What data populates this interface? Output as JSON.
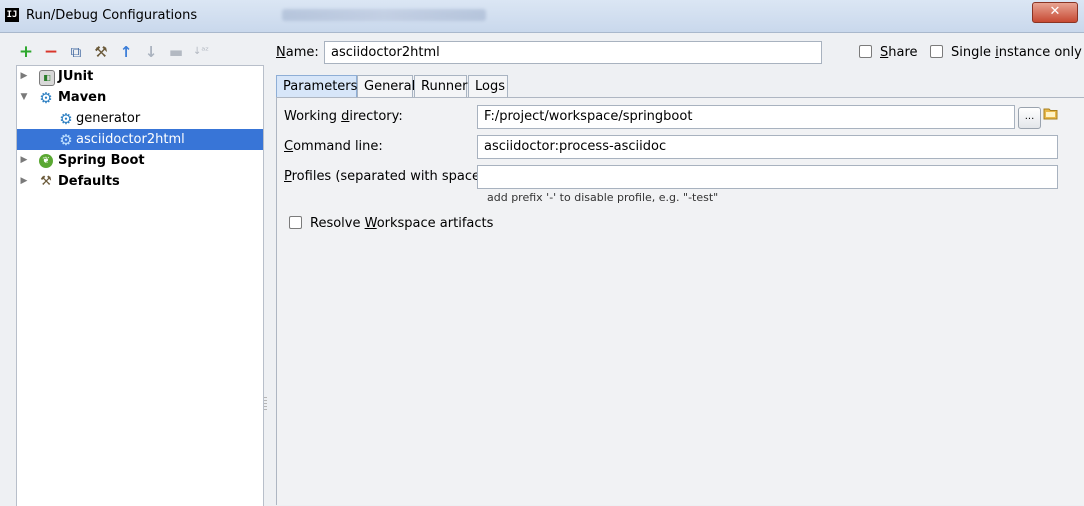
{
  "window": {
    "title": "Run/Debug Configurations",
    "app_icon": "IJ",
    "close_glyph": "✕"
  },
  "toolbar": {
    "add": "+",
    "remove": "−",
    "copy": "⧉",
    "edit_defaults": "⚒",
    "move_up": "↑",
    "move_down": "↓",
    "folder": "▬",
    "sort": "↓ᵃᶻ"
  },
  "tree": {
    "items": [
      {
        "label": "JUnit",
        "expanded": false,
        "icon": "junit-icon"
      },
      {
        "label": "Maven",
        "expanded": true,
        "icon": "maven-gear-icon"
      },
      {
        "label": "generator",
        "icon": "maven-gear-icon"
      },
      {
        "label": "asciidoctor2html",
        "icon": "maven-gear-icon",
        "selected": true
      },
      {
        "label": "Spring Boot",
        "expanded": false,
        "icon": "spring-boot-icon"
      },
      {
        "label": "Defaults",
        "expanded": false,
        "icon": "wrench-icon"
      }
    ]
  },
  "form": {
    "name_label_u": "N",
    "name_label_rest": "ame:",
    "name_value": "asciidoctor2html",
    "share_label_u": "S",
    "share_label_rest": "hare",
    "single_label_pre": "Single ",
    "single_label_u": "i",
    "single_label_rest": "nstance only"
  },
  "tabs": [
    {
      "label": "Parameters",
      "active": true
    },
    {
      "label": "General"
    },
    {
      "label": "Runner"
    },
    {
      "label": "Logs"
    }
  ],
  "params": {
    "wd_label_pre": "Working ",
    "wd_label_u": "d",
    "wd_label_rest": "irectory:",
    "wd_value": "F:/project/workspace/springboot",
    "cmd_label_u": "C",
    "cmd_label_rest": "ommand line:",
    "cmd_value": "asciidoctor:process-asciidoc",
    "prof_label_u": "P",
    "prof_label_rest": "rofiles (separated with space):",
    "prof_value": "",
    "prof_hint": "add prefix '-' to disable profile, e.g. \"-test\"",
    "resolve_pre": "Resolve ",
    "resolve_u": "W",
    "resolve_rest": "orkspace artifacts",
    "browse_label": "..."
  },
  "colors": {
    "selection": "#3875d7",
    "add_green": "#2ea82e",
    "remove_red": "#d9362b",
    "arrow_blue": "#3b7dd8"
  }
}
